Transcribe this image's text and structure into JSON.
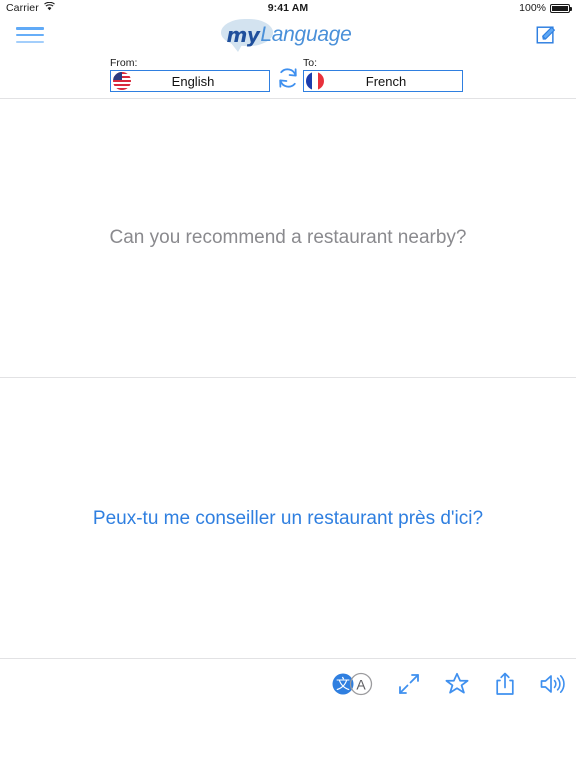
{
  "status_bar": {
    "carrier": "Carrier",
    "wifi_icon": "wifi-icon",
    "time": "9:41 AM",
    "battery_percent": "100%",
    "battery_icon": "battery-full-icon"
  },
  "nav_bar": {
    "menu_icon": "hamburger-menu-icon",
    "logo": {
      "prefix": "my",
      "suffix": "Language"
    },
    "compose_icon": "compose-icon"
  },
  "language_bar": {
    "from": {
      "label": "From:",
      "language": "English",
      "flag": "flag-united-states-icon"
    },
    "to": {
      "label": "To:",
      "language": "French",
      "flag": "flag-france-icon"
    },
    "swap_icon": "swap-languages-icon"
  },
  "panes": {
    "source_text": "Can you recommend a restaurant nearby?",
    "target_text": "Peux-tu me conseiller un restaurant près d'ici?"
  },
  "toolbar": {
    "buttons": [
      {
        "name": "translate-toggle",
        "icon": "translate-icon"
      },
      {
        "name": "expand",
        "icon": "expand-fullscreen-icon"
      },
      {
        "name": "favorite",
        "icon": "star-outline-icon"
      },
      {
        "name": "share",
        "icon": "share-icon"
      },
      {
        "name": "speak",
        "icon": "speaker-icon"
      }
    ]
  },
  "colors": {
    "accent_blue": "#2f7fe0",
    "light_blue": "#57a5f7",
    "logo_dark_blue": "#1f4f9c",
    "logo_light_blue": "#4a90d9",
    "source_text_gray": "#8a8a8e",
    "divider": "#e2e2e4"
  }
}
